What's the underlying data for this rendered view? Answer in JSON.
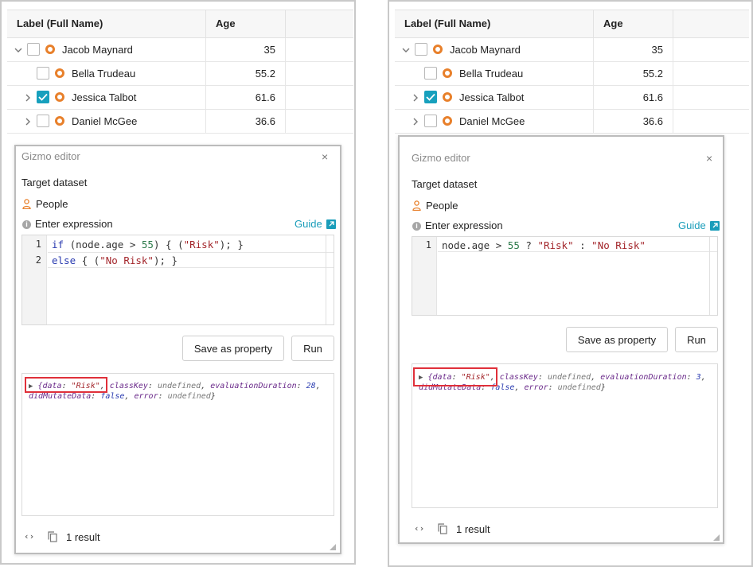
{
  "table": {
    "headers": [
      "Label (Full Name)",
      "Age"
    ],
    "rows": [
      {
        "name": "Jacob Maynard",
        "age": "35",
        "expander": "chevron-down",
        "checked": false
      },
      {
        "name": "Bella Trudeau",
        "age": "55.2",
        "expander": "none",
        "checked": false
      },
      {
        "name": "Jessica Talbot",
        "age": "61.6",
        "expander": "chevron-right",
        "checked": true
      },
      {
        "name": "Daniel McGee",
        "age": "36.6",
        "expander": "chevron-right",
        "checked": false
      }
    ]
  },
  "left": {
    "editor_title": "Gizmo editor",
    "close": "×",
    "target_label": "Target dataset",
    "dataset": "People",
    "expr_label": "Enter expression",
    "guide": "Guide",
    "code_lines": [
      {
        "num": "1",
        "text": "if (node.age > 55) { (\"Risk\"); }"
      },
      {
        "num": "2",
        "text": "else { (\"No Risk\"); }"
      }
    ],
    "save_button": "Save as property",
    "run_button": "Run",
    "result_line1_rest": ", classKey: undefined, evaluationDuration: 28,",
    "result_highlight": "{data: \"Risk\"",
    "result_line2": "didMutateData: false, error: undefined}",
    "result_count": "1 result"
  },
  "right": {
    "editor_title": "Gizmo editor",
    "close": "×",
    "target_label": "Target dataset",
    "dataset": "People",
    "expr_label": "Enter expression",
    "guide": "Guide",
    "code_lines": [
      {
        "num": "1",
        "text": "node.age > 55 ? \"Risk\" : \"No Risk\""
      }
    ],
    "save_button": "Save as property",
    "run_button": "Run",
    "result_line1_rest": ", classKey: undefined, evaluationDuration: 3,",
    "result_highlight": "{data: \"Risk\"",
    "result_line2": "didMutateData: false, error: undefined}",
    "result_count": "1 result"
  },
  "icons": {
    "node": "circle-node-icon",
    "dataset": "person-icon",
    "info": "info-icon",
    "guide": "external-link-icon",
    "braces": "code-braces-icon",
    "copy": "copy-icon",
    "resize": "resize-handle-icon"
  },
  "colors": {
    "accent": "#1a9dba",
    "checkbox_checked": "#17a0bd",
    "node_orange": "#e8802b",
    "highlight_red": "#e0303a"
  }
}
